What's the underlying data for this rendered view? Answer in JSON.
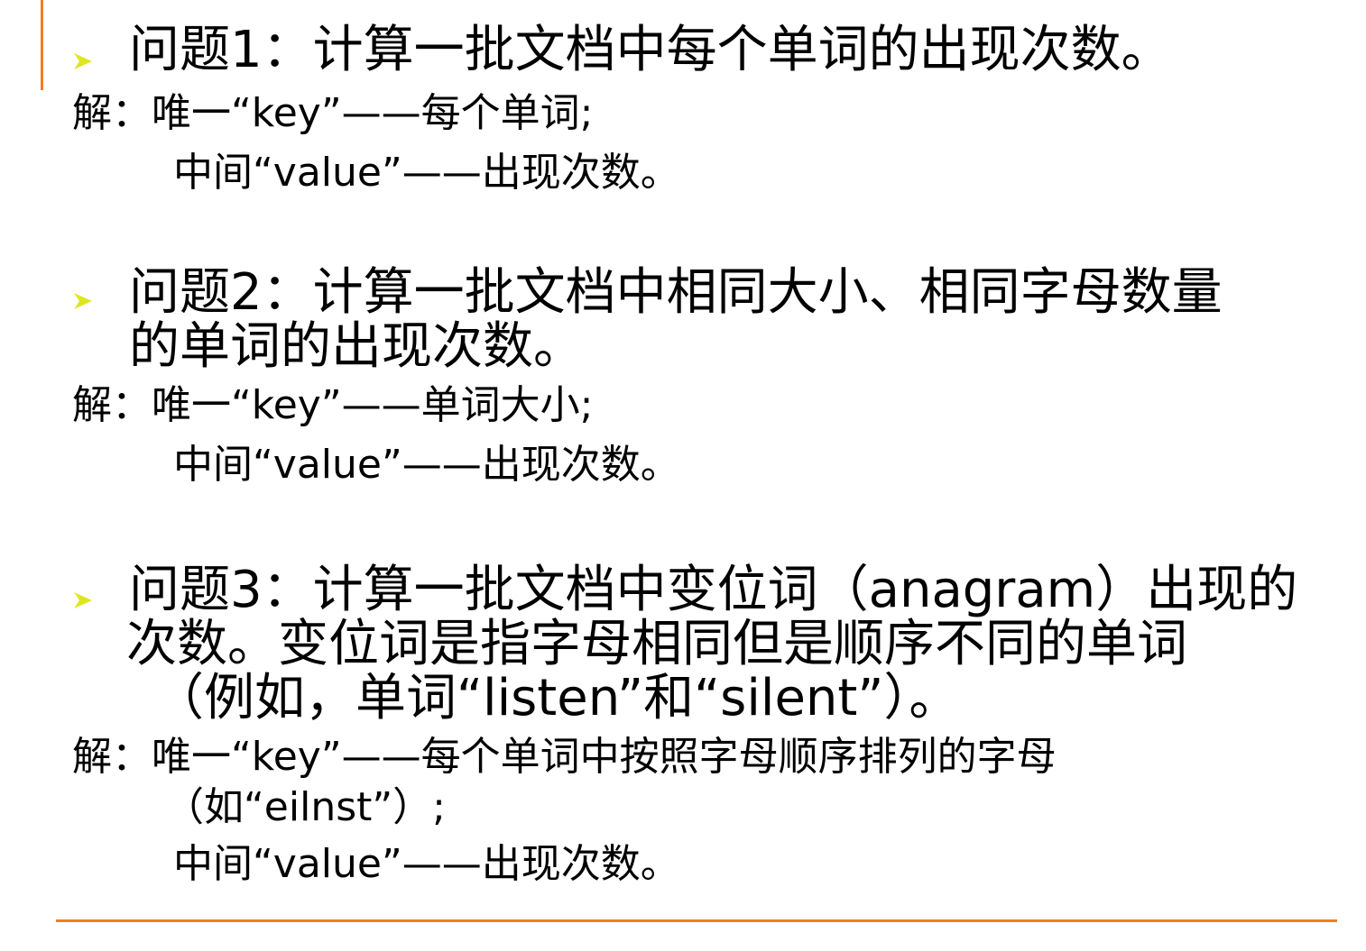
{
  "colors": {
    "accent": "#f07f1f",
    "bullet": "#dfe621"
  },
  "icons": {
    "bullet": "arrowhead-bullet-icon"
  },
  "problems": [
    {
      "question_lines": [
        "问题1：计算一批文档中每个单词的出现次数。"
      ],
      "answer_lines": [
        "解：唯一“key”——每个单词;",
        "中间“value”——出现次数。"
      ]
    },
    {
      "question_lines": [
        "问题2：计算一批文档中相同大小、相同字母数量",
        "的单词的出现次数。"
      ],
      "answer_lines": [
        "解：唯一“key”——单词大小;",
        "中间“value”——出现次数。"
      ]
    },
    {
      "question_lines": [
        "问题3：计算一批文档中变位词（anagram）出现的",
        "次数。变位词是指字母相同但是顺序不同的单词",
        "（例如，单词“listen”和“silent”）。"
      ],
      "answer_lines": [
        "解：唯一“key”——每个单词中按照字母顺序排列的字母",
        "（如“eilnst”）;",
        "中间“value”——出现次数。"
      ]
    }
  ]
}
